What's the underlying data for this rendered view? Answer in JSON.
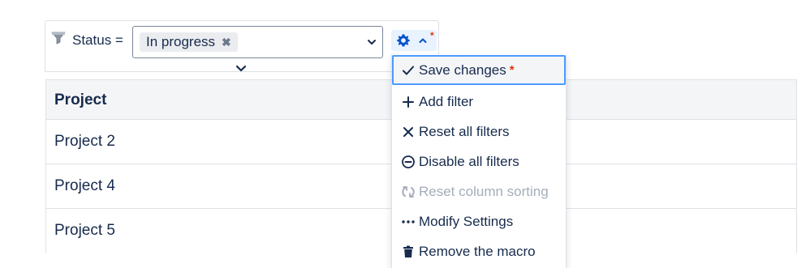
{
  "filter": {
    "label": "Status =",
    "chip_value": "In progress",
    "chip_remove_glyph": "✖",
    "gear_modified_marker": "*"
  },
  "table": {
    "header": "Project",
    "rows": [
      "Project 2",
      "Project 4",
      "Project 5"
    ]
  },
  "menu": {
    "items": [
      {
        "label": "Save changes",
        "marker": "*",
        "icon": "check-icon",
        "state": "focused"
      },
      {
        "label": "Add filter",
        "icon": "plus-icon",
        "state": "enabled"
      },
      {
        "label": "Reset all filters",
        "icon": "close-icon",
        "state": "enabled"
      },
      {
        "label": "Disable all filters",
        "icon": "minus-circle-icon",
        "state": "enabled"
      },
      {
        "label": "Reset column sorting",
        "icon": "refresh-icon",
        "state": "disabled"
      },
      {
        "label": "Modify Settings",
        "icon": "ellipsis-icon",
        "state": "enabled"
      },
      {
        "label": "Remove the macro",
        "icon": "trash-icon",
        "state": "enabled"
      }
    ]
  },
  "colors": {
    "accent": "#0052cc",
    "focus_border": "#4c9aff",
    "required_marker": "#de350b",
    "disabled_text": "#a5adba"
  }
}
